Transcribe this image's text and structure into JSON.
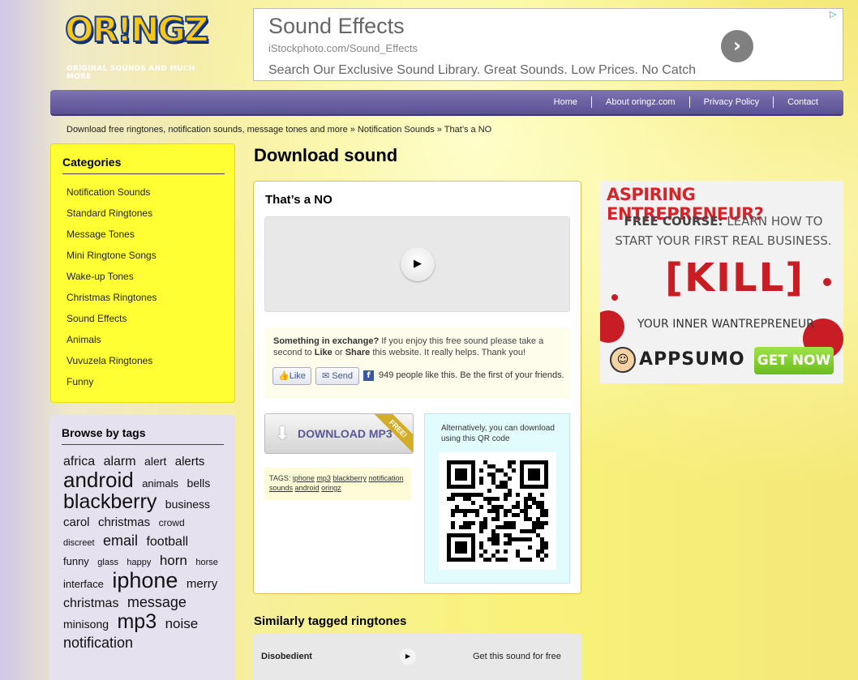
{
  "header": {
    "logo_text": "OR!NGZ",
    "logo_tagline": "ORIGINAL SOUNDS AND MUCH MORE"
  },
  "top_ad": {
    "title": "Sound Effects",
    "url": "iStockphoto.com/Sound_Effects",
    "text": "Search Our Exclusive Sound Library. Great Sounds. Low Prices. No Catch",
    "arrow": "›",
    "adchoices": "▷"
  },
  "nav": {
    "items": [
      {
        "label": "Home"
      },
      {
        "label": "About oringz.com"
      },
      {
        "label": "Privacy Policy"
      },
      {
        "label": "Contact"
      }
    ]
  },
  "breadcrumb": "Download free ringtones, notification sounds, message tones and more » Notification Sounds » That’s a NO",
  "categories": {
    "title": "Categories",
    "items": [
      "Notification Sounds",
      "Standard Ringtones",
      "Message Tones",
      "Mini Ringtone Songs",
      "Wake-up Tones",
      "Christmas Ringtones",
      "Sound Effects",
      "Animals",
      "Vuvuzela Ringtones",
      "Funny"
    ]
  },
  "tags": {
    "title": "Browse by tags",
    "items": [
      {
        "label": "africa",
        "size": 16
      },
      {
        "label": "alarm",
        "size": 16
      },
      {
        "label": "alert",
        "size": 14
      },
      {
        "label": "alerts",
        "size": 15
      },
      {
        "label": "android",
        "size": 26
      },
      {
        "label": "animals",
        "size": 13
      },
      {
        "label": "bells",
        "size": 14
      },
      {
        "label": "blackberry",
        "size": 25
      },
      {
        "label": "business",
        "size": 14
      },
      {
        "label": "carol",
        "size": 15
      },
      {
        "label": "christmas",
        "size": 15
      },
      {
        "label": "crowd",
        "size": 12
      },
      {
        "label": "discreet",
        "size": 11
      },
      {
        "label": "email",
        "size": 18
      },
      {
        "label": "football",
        "size": 16
      },
      {
        "label": "funny",
        "size": 13
      },
      {
        "label": "glass",
        "size": 11
      },
      {
        "label": "happy",
        "size": 11
      },
      {
        "label": "horn",
        "size": 17
      },
      {
        "label": "horse",
        "size": 11
      },
      {
        "label": "interface",
        "size": 13
      },
      {
        "label": "iphone",
        "size": 27
      },
      {
        "label": "merry",
        "size": 15
      },
      {
        "label": "christmas",
        "size": 16
      },
      {
        "label": "message",
        "size": 18
      },
      {
        "label": "minisong",
        "size": 14
      },
      {
        "label": "mp3",
        "size": 25
      },
      {
        "label": "noise",
        "size": 17
      },
      {
        "label": "notification",
        "size": 18
      }
    ]
  },
  "main": {
    "title": "Download sound",
    "sound_name": "That’s a NO",
    "play_symbol": "▶",
    "exchange_bold": "Something in exchange?",
    "exchange_text_1": " If you enjoy this free sound please take a second to ",
    "like_bold": "Like",
    "exchange_or": " or ",
    "share_bold": "Share",
    "exchange_text_2": " this website. It really helps. Thank you!",
    "fb_like": "Like",
    "fb_send": "Send",
    "fb_icon": "f",
    "fb_count": "949 people like this. Be the first of your friends.",
    "download_label": "DOWNLOAD MP3",
    "download_icon": "⬇",
    "free_ribbon": "FREE!",
    "tags_label": "TAGS:",
    "tag_links": [
      "iphone",
      "mp3",
      "blackberry",
      "notification sounds",
      "android",
      "oringz"
    ],
    "qr_text": "Alternatively, you can download using this QR code"
  },
  "right_ad": {
    "headline": "ASPIRING ENTREPRENEUR?",
    "course_bold": "FREE COURSE:",
    "course_text": " LEARN HOW TO START YOUR FIRST REAL BUSINESS.",
    "kill": "[KILL]",
    "sub": "YOUR INNER WANTREPRENEUR",
    "brand": "APPSUMO",
    "cta": "GET NOW »",
    "adchoices": "▷",
    "colors": {
      "red": "#c81d24",
      "green": "#7bc62c"
    }
  },
  "similar": {
    "title": "Similarly tagged ringtones",
    "rows": [
      {
        "name": "Disobedient",
        "play": "▶",
        "cta": "Get this sound for free"
      }
    ]
  }
}
